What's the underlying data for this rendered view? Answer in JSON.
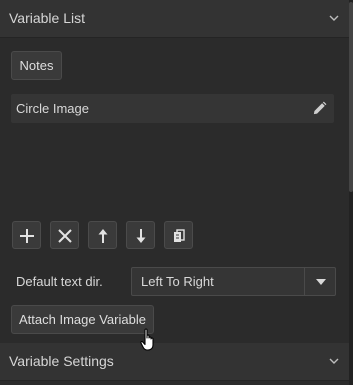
{
  "sections": {
    "variable_list": {
      "title": "Variable List"
    },
    "variable_settings": {
      "title": "Variable Settings"
    }
  },
  "notes_button": "Notes",
  "variables": [
    {
      "label": "Circle Image"
    }
  ],
  "toolbar": {
    "icons": [
      "add-icon",
      "delete-icon",
      "move-up-icon",
      "move-down-icon",
      "duplicate-icon"
    ]
  },
  "text_direction": {
    "label": "Default text dir.",
    "value": "Left To Right"
  },
  "attach_button": "Attach Image Variable"
}
